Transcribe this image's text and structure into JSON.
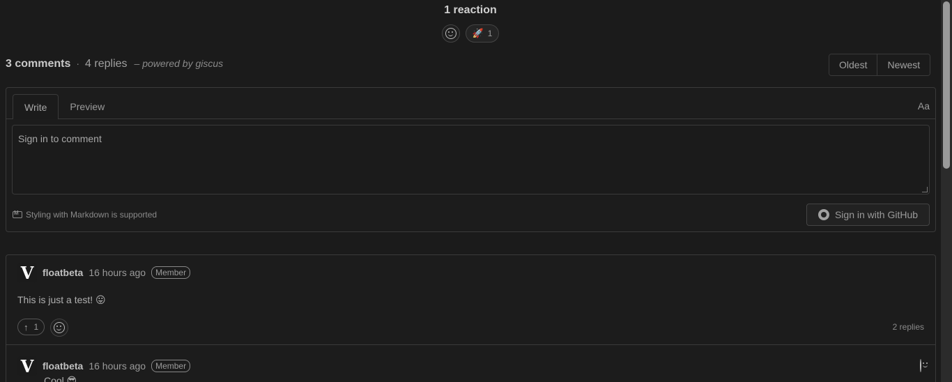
{
  "reactions": {
    "title": "1 reaction",
    "items": [
      {
        "icon": "rocket-icon",
        "emoji": "🚀",
        "count": "1"
      }
    ]
  },
  "counts": {
    "comments": "3 comments",
    "separator": "·",
    "replies": "4 replies",
    "powered_prefix": "– powered by ",
    "powered_link": "giscus"
  },
  "sort": {
    "oldest": "Oldest",
    "newest": "Newest"
  },
  "editor": {
    "tab_write": "Write",
    "tab_preview": "Preview",
    "format_toggle": "Aa",
    "placeholder": "Sign in to comment",
    "markdown_note": "Styling with Markdown is supported",
    "signin_label": "Sign in with GitHub"
  },
  "comments": [
    {
      "avatar_letter": "V",
      "author": "floatbeta",
      "time": "16 hours ago",
      "badge": "Member",
      "body": "This is just a test! 😛",
      "upvotes": "1",
      "replies": "2 replies"
    },
    {
      "avatar_letter": "V",
      "author": "floatbeta",
      "time": "16 hours ago",
      "badge": "Member",
      "body": "Cool 😎"
    }
  ]
}
